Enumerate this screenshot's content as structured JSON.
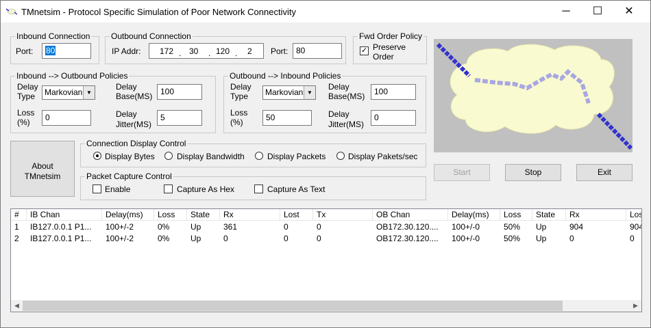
{
  "window": {
    "title": "TMnetsim - Protocol Specific Simulation of Poor Network Connectivity",
    "minimize_glyph": "─",
    "maximize_glyph": "☐",
    "close_glyph": "✕"
  },
  "inbound_connection": {
    "legend": "Inbound Connection",
    "port_label": "Port:",
    "port_value": "80"
  },
  "outbound_connection": {
    "legend": "Outbound Connection",
    "ip_label": "IP Addr:",
    "ip_octets": [
      "172",
      "30",
      "120",
      "2"
    ],
    "ip_dot": ".",
    "port_label": "Port:",
    "port_value": "80"
  },
  "fwd_order_policy": {
    "legend": "Fwd Order Policy",
    "preserve_line1": "Preserve",
    "preserve_line2": "Order",
    "preserve_checked": true,
    "check_glyph": "✓"
  },
  "in_out_policies": {
    "legend": "Inbound --> Outbound  Policies",
    "delay_type_l1": "Delay",
    "delay_type_l2": "Type",
    "delay_type_value": "Markovian",
    "delay_base_l1": "Delay",
    "delay_base_l2": "Base(MS)",
    "delay_base_value": "100",
    "loss_l1": "Loss",
    "loss_l2": "(%)",
    "loss_value": "0",
    "jitter_l1": "Delay",
    "jitter_l2": "Jitter(MS)",
    "jitter_value": "5"
  },
  "out_in_policies": {
    "legend": "Outbound --> Inbound  Policies",
    "delay_type_l1": "Delay",
    "delay_type_l2": "Type",
    "delay_type_value": "Markovian",
    "delay_base_l1": "Delay",
    "delay_base_l2": "Base(MS)",
    "delay_base_value": "100",
    "loss_l1": "Loss",
    "loss_l2": "(%)",
    "loss_value": "50",
    "jitter_l1": "Delay",
    "jitter_l2": "Jitter(MS)",
    "jitter_value": "0"
  },
  "about_button": {
    "line1": "About",
    "line2": "TMnetsim"
  },
  "connection_display": {
    "legend": "Connection Display Control",
    "options": [
      "Display Bytes",
      "Display Bandwidth",
      "Display Packets",
      "Display Pakets/sec"
    ],
    "selected": "Display Bytes"
  },
  "packet_capture": {
    "legend": "Packet Capture Control",
    "options": [
      "Enable",
      "Capture As Hex",
      "Capture As Text"
    ]
  },
  "actions": {
    "start": "Start",
    "stop": "Stop",
    "exit": "Exit"
  },
  "table": {
    "headers": [
      "#",
      "IB Chan",
      "Delay(ms)",
      "Loss",
      "State",
      "Rx",
      "Lost",
      "Tx",
      "OB Chan",
      "Delay(ms)",
      "Loss",
      "State",
      "Rx",
      "Los"
    ],
    "rows": [
      [
        "1",
        "IB127.0.0.1 P1...",
        "100+/-2",
        "0%",
        "Up",
        "361",
        "0",
        "0",
        "OB172.30.120....",
        "100+/-0",
        "50%",
        "Up",
        "904",
        "904"
      ],
      [
        "2",
        "IB127.0.0.1 P1...",
        "100+/-2",
        "0%",
        "Up",
        "0",
        "0",
        "0",
        "OB172.30.120....",
        "100+/-0",
        "50%",
        "Up",
        "0",
        "0"
      ]
    ],
    "scroll_left_glyph": "◀",
    "scroll_right_glyph": "▶"
  },
  "icons": {
    "app": "network-cloud-icon",
    "dropdown": "chevron-down-icon"
  },
  "colors": {
    "selection": "#0078d7",
    "cloud": "#fafad0",
    "link_dark": "#3333cc",
    "link_light": "#a8a8e0",
    "canvas_bg": "#c0c0c0"
  }
}
